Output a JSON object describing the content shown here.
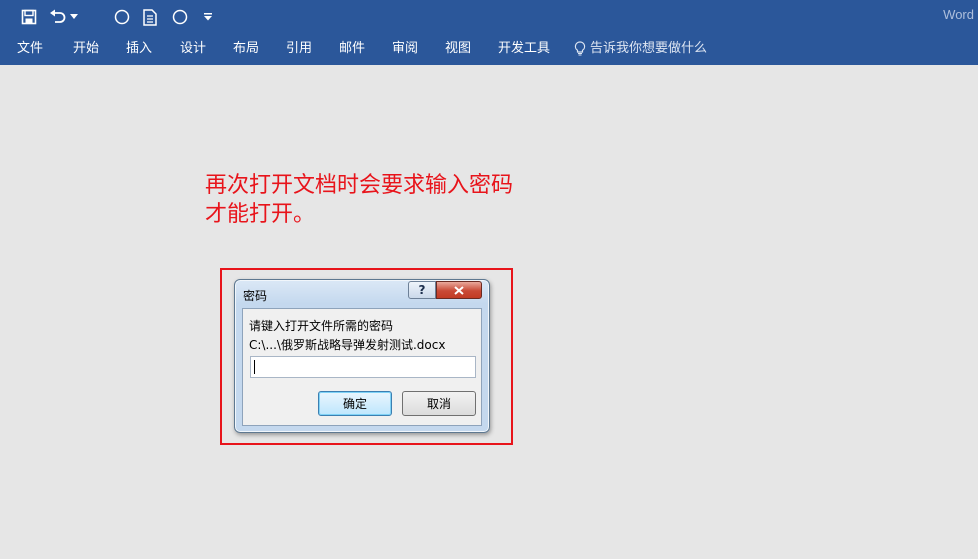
{
  "app": {
    "name": "Word"
  },
  "qat": {
    "icons": [
      "save-icon",
      "undo-icon",
      "chevron-down-icon",
      "circle-icon",
      "document-icon",
      "circle-icon",
      "customize-dropdown-icon"
    ]
  },
  "ribbon": {
    "tabs": [
      {
        "label": "文件"
      },
      {
        "label": "开始"
      },
      {
        "label": "插入"
      },
      {
        "label": "设计"
      },
      {
        "label": "布局"
      },
      {
        "label": "引用"
      },
      {
        "label": "邮件"
      },
      {
        "label": "审阅"
      },
      {
        "label": "视图"
      },
      {
        "label": "开发工具"
      }
    ],
    "tell_me": "告诉我你想要做什么"
  },
  "annotation": {
    "line1": "再次打开文档时会要求输入密码",
    "line2": "才能打开。",
    "color": "#e8141b"
  },
  "dialog": {
    "title": "密码",
    "help_label": "?",
    "prompt": "请键入打开文件所需的密码",
    "path": "C:\\...\\俄罗斯战略导弹发射测试.docx",
    "password_value": "",
    "ok_label": "确定",
    "cancel_label": "取消"
  },
  "colors": {
    "ribbon": "#2b579a",
    "background": "#e6e6e6"
  }
}
